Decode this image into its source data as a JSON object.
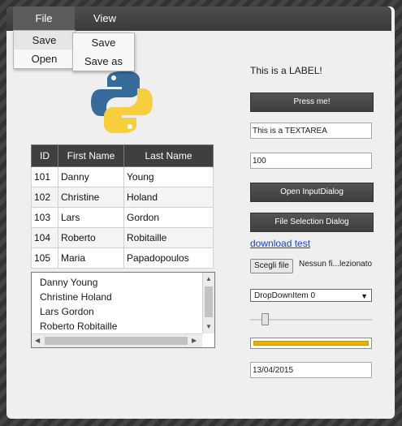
{
  "menu": {
    "file_title": "File",
    "view_title": "View",
    "file_items": [
      "Save",
      "Open"
    ],
    "view_items": [
      "Save",
      "Save as"
    ]
  },
  "logo": {
    "icon": "python-logo-icon",
    "colors": {
      "blue": "#366b9c",
      "yellow": "#f7cf3d"
    }
  },
  "table": {
    "headers": [
      "ID",
      "First Name",
      "Last Name"
    ],
    "rows": [
      [
        "101",
        "Danny",
        "Young"
      ],
      [
        "102",
        "Christine",
        "Holand"
      ],
      [
        "103",
        "Lars",
        "Gordon"
      ],
      [
        "104",
        "Roberto",
        "Robitaille"
      ],
      [
        "105",
        "Maria",
        "Papadopoulos"
      ]
    ]
  },
  "listbox": {
    "items": [
      "Danny Young",
      "Christine Holand",
      "Lars Gordon",
      "Roberto Robitaille"
    ]
  },
  "controls": {
    "label": "This is a LABEL!",
    "press_button": "Press me!",
    "textarea_value": "This is a TEXTAREA",
    "number_value": "100",
    "input_dialog_button": "Open InputDialog",
    "file_dialog_button": "File Selection Dialog",
    "download_link": "download test",
    "file_button": "Scegli file",
    "file_name": "Nessun fi...lezionato",
    "dropdown_value": "DropDownItem 0",
    "slider_value": 0.1,
    "progress_value": 1.0,
    "date_value": "13/04/2015"
  },
  "colors": {
    "accent_dark": "#3f3f3f",
    "progress": "#e8b300",
    "link": "#1a44c8"
  }
}
